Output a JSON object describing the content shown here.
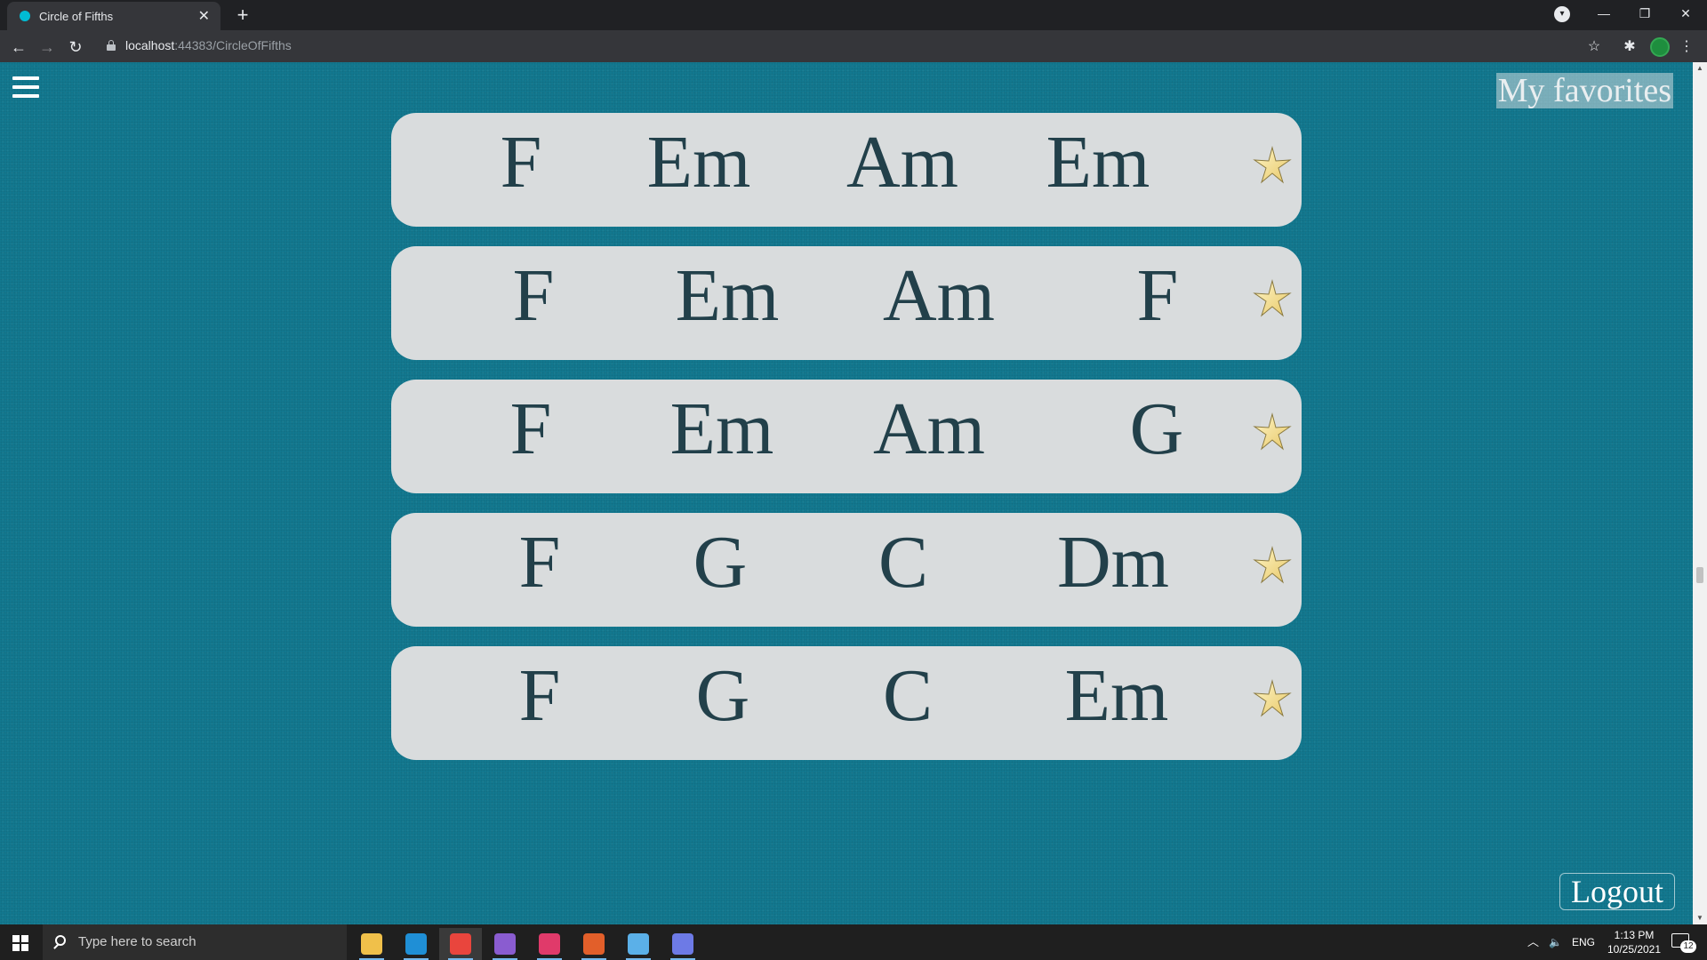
{
  "browser": {
    "tab_title": "Circle of Fifths",
    "new_tab_label": "+",
    "url_host": "localhost",
    "url_rest": ":44383/CircleOfFifths",
    "window_controls": {
      "minimize": "—",
      "restore": "❐",
      "close": "✕"
    }
  },
  "page": {
    "favorites_label": "My favorites",
    "logout_label": "Logout",
    "progressions": [
      {
        "chords": [
          "F",
          "Em",
          "Am",
          "Em"
        ]
      },
      {
        "chords": [
          "F",
          "Em",
          "Am",
          "F"
        ]
      },
      {
        "chords": [
          "F",
          "Em",
          "Am",
          "G"
        ]
      },
      {
        "chords": [
          "F",
          "G",
          "C",
          "Dm"
        ]
      },
      {
        "chords": [
          "F",
          "G",
          "C",
          "Em"
        ]
      }
    ],
    "favorite_icon": "star-icon",
    "colors": {
      "background": "#12788f",
      "card": "#d9dcdd",
      "chord_text": "#22404a",
      "star": "#f2e29a"
    }
  },
  "taskbar": {
    "search_placeholder": "Type here to search",
    "language": "ENG",
    "time": "1:13 PM",
    "date": "10/25/2021",
    "notification_count": "12",
    "apps": [
      "file-explorer-icon",
      "edge-icon",
      "chrome-icon",
      "visual-studio-icon",
      "jetbrains-icon",
      "git-icon",
      "paint-icon",
      "discord-icon"
    ]
  }
}
